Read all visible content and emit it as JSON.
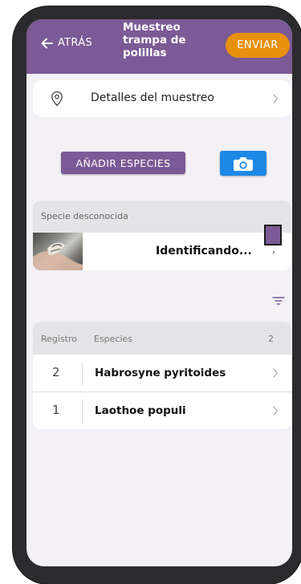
{
  "header": {
    "back_label": "ATRÁS",
    "title": "Muestreo trampa de polillas",
    "send_label": "ENVIAR"
  },
  "details": {
    "label": "Detalles del muestreo"
  },
  "actions": {
    "add_species_label": "AÑADIR ESPECIES",
    "camera_icon": "camera-icon"
  },
  "unknown_species": {
    "heading": "Specie desconocida",
    "status": "Identificando...",
    "row_chevron": ","
  },
  "records": {
    "col_registro": "Registro",
    "col_especies": "Especies",
    "count": "2",
    "rows": [
      {
        "count": "2",
        "species": "Habrosyne pyritoides"
      },
      {
        "count": "1",
        "species": "Laothoe populi"
      }
    ]
  },
  "colors": {
    "header": "#7b5a95",
    "send": "#e8910f",
    "camera": "#1e88e5",
    "background": "#f3f1f6"
  }
}
